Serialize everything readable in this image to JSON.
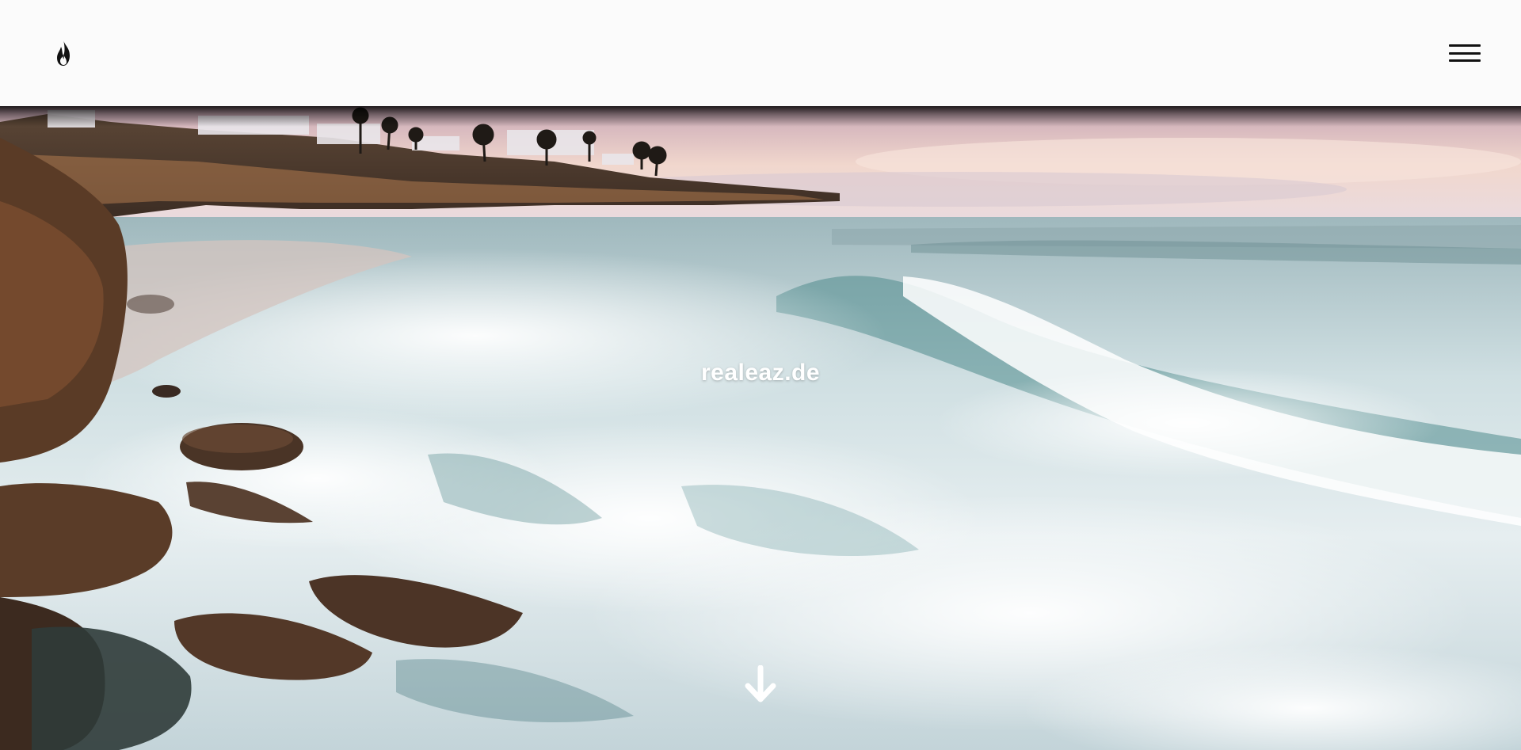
{
  "header": {
    "logo_icon": "flame-icon",
    "menu_icon": "hamburger-menu-icon"
  },
  "hero": {
    "title": "realeaz.de",
    "scroll_icon": "arrow-down-icon",
    "background": "coastal-waves-sunset-photo"
  },
  "colors": {
    "header_bg": "#fbfbfb",
    "icon_dark": "#111111",
    "title_text": "#ffffff"
  }
}
